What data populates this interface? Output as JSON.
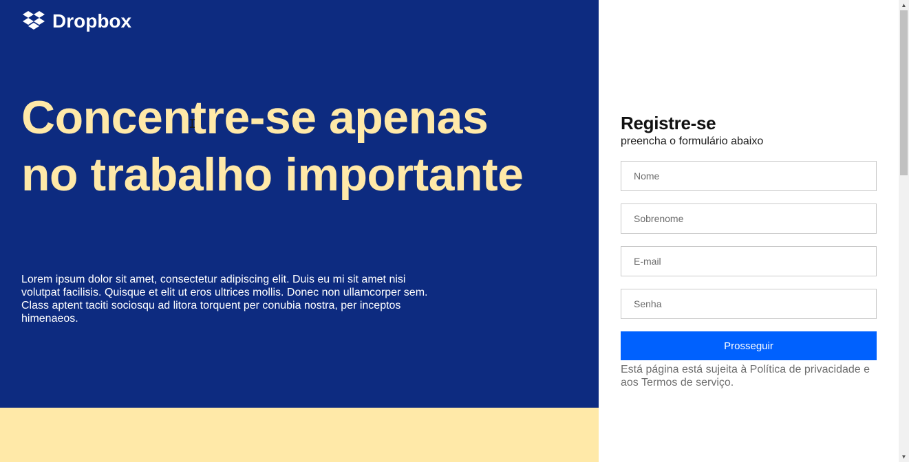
{
  "brand": {
    "name": "Dropbox",
    "logo_icon": "dropbox-box-icon",
    "colors": {
      "navy": "#0d2b80",
      "cream": "#ffe9a8",
      "primary_button": "#0061fe"
    }
  },
  "hero": {
    "headline": "Concentre-se apenas no trabalho importante",
    "body": "Lorem ipsum dolor sit amet, consectetur adipiscing elit. Duis eu mi sit amet nisi volutpat facilisis. Quisque et elit ut eros ultrices mollis. Donec non ullamcorper sem. Class aptent taciti sociosqu ad litora torquent per conubia nostra, per inceptos himenaeos."
  },
  "form": {
    "title": "Registre-se",
    "subtitle": "preencha o formulário abaixo",
    "fields": {
      "first_name": {
        "placeholder": "Nome",
        "value": ""
      },
      "last_name": {
        "placeholder": "Sobrenome",
        "value": ""
      },
      "email": {
        "placeholder": "E-mail",
        "value": ""
      },
      "password": {
        "placeholder": "Senha",
        "value": ""
      }
    },
    "submit_label": "Prosseguir",
    "terms": "Está página está sujeita à Política de privacidade e aos Termos de serviço."
  },
  "scrollbar": {
    "up_icon": "scroll-up-arrow-icon",
    "down_icon": "scroll-down-arrow-icon"
  }
}
